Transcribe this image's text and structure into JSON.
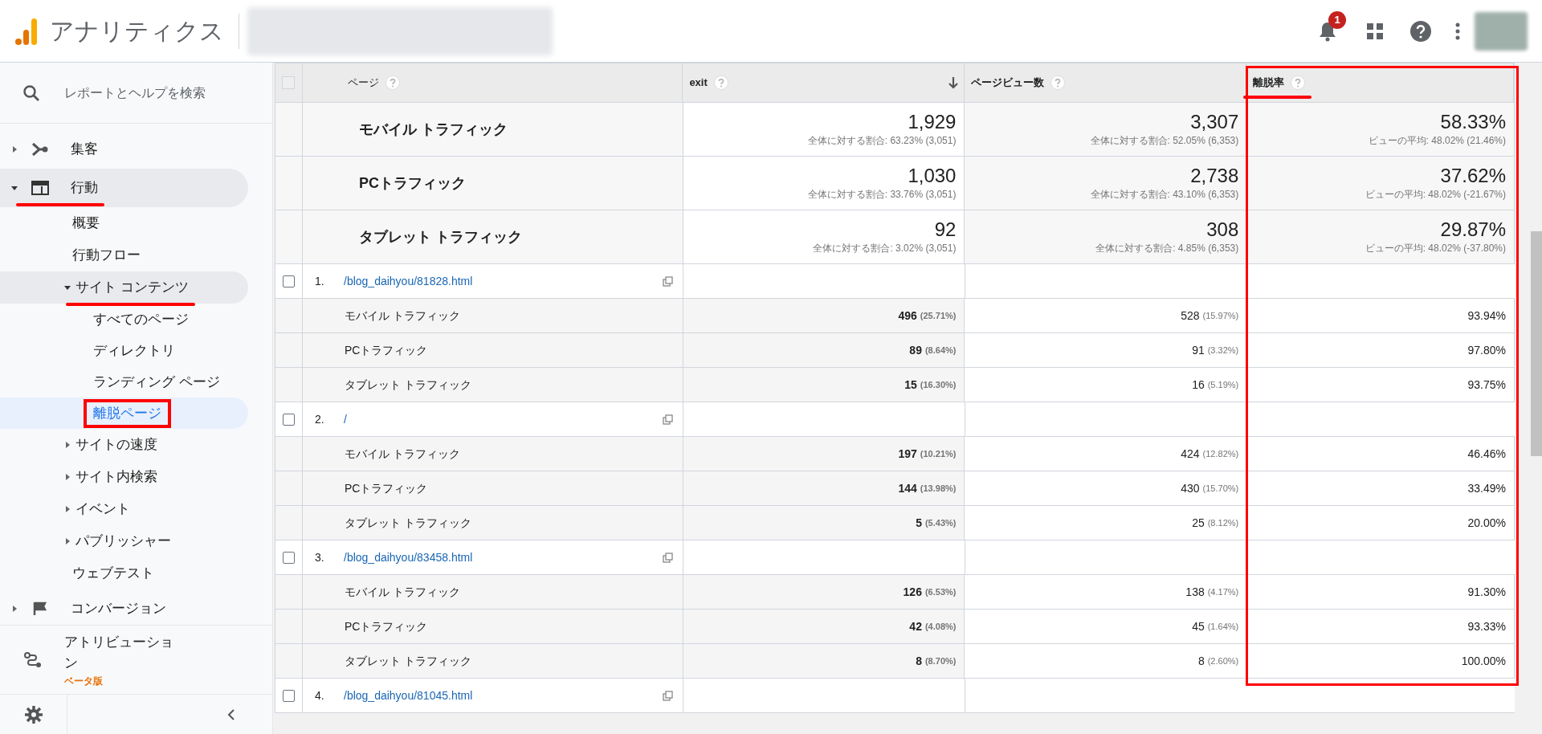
{
  "header": {
    "app_title": "アナリティクス",
    "notification_count": "1"
  },
  "sidebar": {
    "search": {
      "placeholder": "レポートとヘルプを検索"
    },
    "items": [
      {
        "label": "集客",
        "expanded": false,
        "selected": false,
        "highlighted": false
      },
      {
        "label": "行動",
        "expanded": true,
        "selected": true,
        "highlighted": true,
        "children": [
          {
            "label": "概要",
            "selected": false,
            "highlighted": false
          },
          {
            "label": "行動フロー",
            "selected": false,
            "highlighted": false
          },
          {
            "label": "サイト コンテンツ",
            "expanded": true,
            "selected": true,
            "highlighted": true,
            "children": [
              {
                "label": "すべてのページ",
                "selected": false,
                "highlighted": false
              },
              {
                "label": "ディレクトリ",
                "selected": false,
                "highlighted": false
              },
              {
                "label": "ランディング ページ",
                "selected": false,
                "highlighted": false
              },
              {
                "label": "離脱ページ",
                "selected": true,
                "highlighted": true
              }
            ]
          },
          {
            "label": "サイトの速度",
            "expanded": false,
            "selected": false,
            "highlighted": false
          },
          {
            "label": "サイト内検索",
            "expanded": false,
            "selected": false,
            "highlighted": false
          },
          {
            "label": "イベント",
            "expanded": false,
            "selected": false,
            "highlighted": false
          },
          {
            "label": "パブリッシャー",
            "expanded": false,
            "selected": false,
            "highlighted": false
          },
          {
            "label": "ウェブテスト",
            "selected": false,
            "highlighted": false
          }
        ]
      },
      {
        "label": "コンバージョン",
        "expanded": false,
        "selected": false,
        "highlighted": false
      }
    ],
    "attribution": {
      "label": "アトリビューション",
      "badge": "ベータ版"
    }
  },
  "table": {
    "all_selected": false,
    "columns": [
      {
        "label": "ページ",
        "sorted": false,
        "highlighted": false
      },
      {
        "label": "exit",
        "sorted": true,
        "highlighted": false
      },
      {
        "label": "ページビュー数",
        "sorted": false,
        "highlighted": false
      },
      {
        "label": "離脱率",
        "sorted": false,
        "highlighted": true
      }
    ],
    "summary_rows": [
      {
        "label": "モバイル トラフィック",
        "cells": [
          {
            "value": "1,929",
            "note": "全体に対する割合: 63.23% (3,051)"
          },
          {
            "value": "3,307",
            "note": "全体に対する割合: 52.05% (6,353)"
          },
          {
            "value": "58.33%",
            "note": "ビューの平均: 48.02% (21.46%)"
          }
        ]
      },
      {
        "label": "PCトラフィック",
        "cells": [
          {
            "value": "1,030",
            "note": "全体に対する割合: 33.76% (3,051)"
          },
          {
            "value": "2,738",
            "note": "全体に対する割合: 43.10% (6,353)"
          },
          {
            "value": "37.62%",
            "note": "ビューの平均: 48.02% (-21.67%)"
          }
        ]
      },
      {
        "label": "タブレット トラフィック",
        "cells": [
          {
            "value": "92",
            "note": "全体に対する割合: 3.02% (3,051)"
          },
          {
            "value": "308",
            "note": "全体に対する割合: 4.85% (6,353)"
          },
          {
            "value": "29.87%",
            "note": "ビューの平均: 48.02% (-37.80%)"
          }
        ]
      }
    ],
    "pages": [
      {
        "index": "1.",
        "path": "/blog_daihyou/81828.html",
        "checked": false,
        "rows": [
          {
            "label": "モバイル トラフィック",
            "exit": "496",
            "exit_pct": "(25.71%)",
            "views": "528",
            "views_pct": "(15.97%)",
            "bounce": "93.94%"
          },
          {
            "label": "PCトラフィック",
            "exit": "89",
            "exit_pct": "(8.64%)",
            "views": "91",
            "views_pct": "(3.32%)",
            "bounce": "97.80%"
          },
          {
            "label": "タブレット トラフィック",
            "exit": "15",
            "exit_pct": "(16.30%)",
            "views": "16",
            "views_pct": "(5.19%)",
            "bounce": "93.75%"
          }
        ]
      },
      {
        "index": "2.",
        "path": "/",
        "checked": false,
        "rows": [
          {
            "label": "モバイル トラフィック",
            "exit": "197",
            "exit_pct": "(10.21%)",
            "views": "424",
            "views_pct": "(12.82%)",
            "bounce": "46.46%"
          },
          {
            "label": "PCトラフィック",
            "exit": "144",
            "exit_pct": "(13.98%)",
            "views": "430",
            "views_pct": "(15.70%)",
            "bounce": "33.49%"
          },
          {
            "label": "タブレット トラフィック",
            "exit": "5",
            "exit_pct": "(5.43%)",
            "views": "25",
            "views_pct": "(8.12%)",
            "bounce": "20.00%"
          }
        ]
      },
      {
        "index": "3.",
        "path": "/blog_daihyou/83458.html",
        "checked": false,
        "rows": [
          {
            "label": "モバイル トラフィック",
            "exit": "126",
            "exit_pct": "(6.53%)",
            "views": "138",
            "views_pct": "(4.17%)",
            "bounce": "91.30%"
          },
          {
            "label": "PCトラフィック",
            "exit": "42",
            "exit_pct": "(4.08%)",
            "views": "45",
            "views_pct": "(1.64%)",
            "bounce": "93.33%"
          },
          {
            "label": "タブレット トラフィック",
            "exit": "8",
            "exit_pct": "(8.70%)",
            "views": "8",
            "views_pct": "(2.60%)",
            "bounce": "100.00%"
          }
        ]
      },
      {
        "index": "4.",
        "path": "/blog_daihyou/81045.html",
        "checked": false
      }
    ]
  }
}
